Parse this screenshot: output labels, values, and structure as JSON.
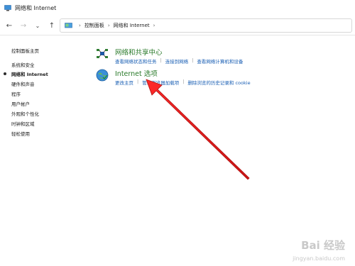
{
  "window": {
    "title": "网络和 Internet"
  },
  "nav": {
    "back": "←",
    "forward": "→",
    "recent": "⌄",
    "up": "↑",
    "breadcrumb": [
      "控制面板",
      "网络和 Internet"
    ]
  },
  "sidebar": {
    "items": [
      {
        "label": "控制面板主页"
      },
      {
        "label": "系统和安全"
      },
      {
        "label": "网络和 Internet",
        "current": true
      },
      {
        "label": "硬件和声音"
      },
      {
        "label": "程序"
      },
      {
        "label": "用户帐户"
      },
      {
        "label": "外观和个性化"
      },
      {
        "label": "时钟和区域"
      },
      {
        "label": "轻松使用"
      }
    ]
  },
  "main": {
    "sections": [
      {
        "heading": "网络和共享中心",
        "icon": "network-sharing-icon",
        "links": [
          "查看网络状态和任务",
          "连接到网络",
          "查看网络计算机和设备"
        ]
      },
      {
        "heading": "Internet 选项",
        "icon": "internet-options-icon",
        "links": [
          "更改主页",
          "管理浏览器加载项",
          "删除浏览的历史记录和 cookie"
        ]
      }
    ]
  },
  "annotation": {
    "type": "red-arrow",
    "color": "#e02020"
  },
  "watermark": {
    "brand": "Bai 经验",
    "site": "jingyan.baidu.com"
  },
  "colors": {
    "heading": "#2a7a2a",
    "link": "#1a5fb4",
    "arrow": "#e02020"
  }
}
